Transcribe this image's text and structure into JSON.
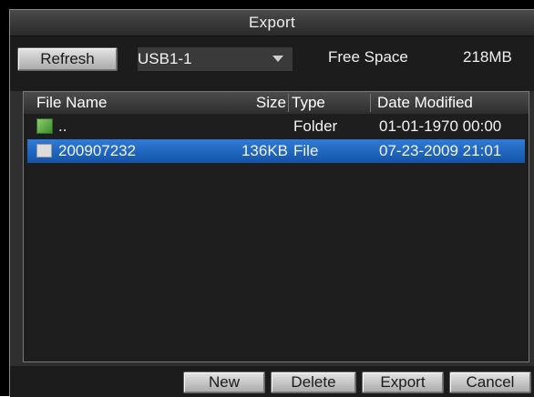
{
  "window": {
    "title": "Export"
  },
  "toolbar": {
    "refresh_label": "Refresh",
    "device_value": "USB1-1",
    "free_space_label": "Free Space",
    "free_space_value": "218MB"
  },
  "table": {
    "headers": {
      "name": "File Name",
      "size": "Size",
      "type": "Type",
      "date": "Date Modified"
    },
    "rows": [
      {
        "name": "..",
        "size": "",
        "type": "Folder",
        "date": "01-01-1970 00:00",
        "icon": "folder-icon",
        "selected": false
      },
      {
        "name": "200907232",
        "size": "136KB",
        "type": "File",
        "date": "07-23-2009 21:01",
        "icon": "file-icon",
        "selected": true
      }
    ]
  },
  "actions": {
    "new_label": "New",
    "delete_label": "Delete",
    "export_label": "Export",
    "cancel_label": "Cancel"
  },
  "colors": {
    "selection": "#1e66c4",
    "panel_bg": "#1e1e1e",
    "window_bg": "#2f2f2f"
  }
}
